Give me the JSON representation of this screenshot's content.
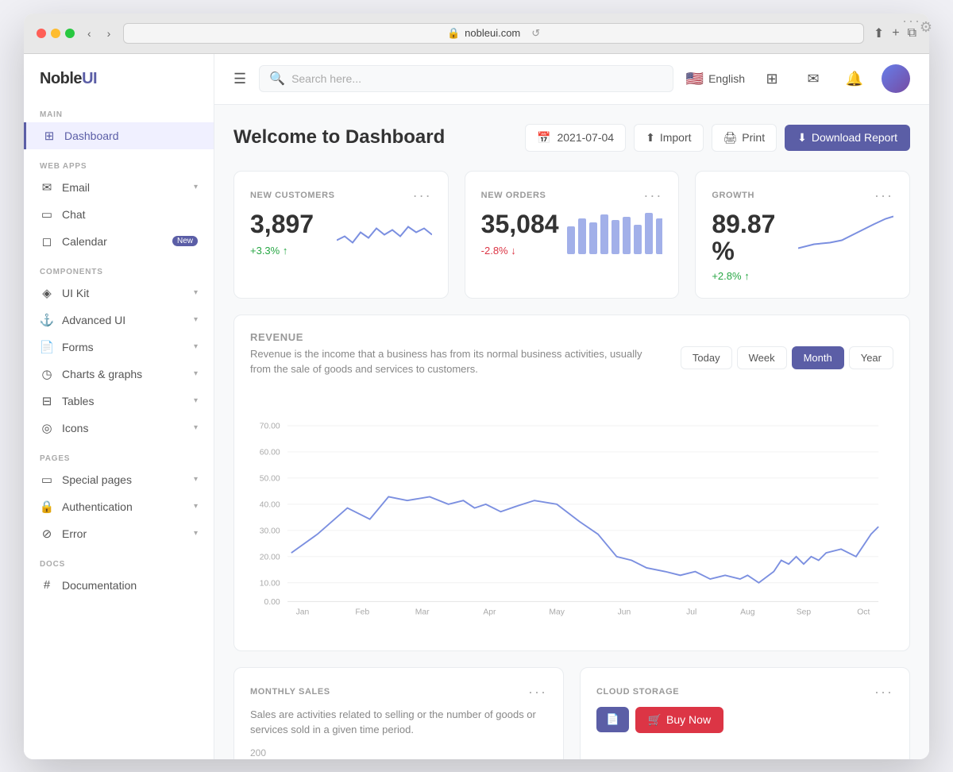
{
  "browser": {
    "url": "nobleui.com",
    "lock_icon": "🔒",
    "reload_icon": "↺"
  },
  "app": {
    "logo_noble": "Noble",
    "logo_ui": "UI"
  },
  "sidebar": {
    "sections": [
      {
        "title": "MAIN",
        "items": [
          {
            "id": "dashboard",
            "label": "Dashboard",
            "icon": "⊞",
            "active": true,
            "badge": ""
          }
        ]
      },
      {
        "title": "WEB APPS",
        "items": [
          {
            "id": "email",
            "label": "Email",
            "icon": "✉",
            "active": false,
            "badge": "",
            "hasArrow": true
          },
          {
            "id": "chat",
            "label": "Chat",
            "icon": "▭",
            "active": false,
            "badge": ""
          },
          {
            "id": "calendar",
            "label": "Calendar",
            "icon": "📅",
            "active": false,
            "badge": "New"
          }
        ]
      },
      {
        "title": "COMPONENTS",
        "items": [
          {
            "id": "ui-kit",
            "label": "UI Kit",
            "icon": "◈",
            "active": false,
            "badge": "",
            "hasArrow": true
          },
          {
            "id": "advanced-ui",
            "label": "Advanced UI",
            "icon": "⚓",
            "active": false,
            "badge": "",
            "hasArrow": true
          },
          {
            "id": "forms",
            "label": "Forms",
            "icon": "📄",
            "active": false,
            "badge": "",
            "hasArrow": true
          },
          {
            "id": "charts",
            "label": "Charts & graphs",
            "icon": "◷",
            "active": false,
            "badge": "",
            "hasArrow": true
          },
          {
            "id": "tables",
            "label": "Tables",
            "icon": "⊟",
            "active": false,
            "badge": "",
            "hasArrow": true
          },
          {
            "id": "icons",
            "label": "Icons",
            "icon": "◎",
            "active": false,
            "badge": "",
            "hasArrow": true
          }
        ]
      },
      {
        "title": "PAGES",
        "items": [
          {
            "id": "special-pages",
            "label": "Special pages",
            "icon": "▭",
            "active": false,
            "badge": "",
            "hasArrow": true
          },
          {
            "id": "authentication",
            "label": "Authentication",
            "icon": "🔒",
            "active": false,
            "badge": "",
            "hasArrow": true
          },
          {
            "id": "error",
            "label": "Error",
            "icon": "⊘",
            "active": false,
            "badge": "",
            "hasArrow": true
          }
        ]
      },
      {
        "title": "DOCS",
        "items": [
          {
            "id": "documentation",
            "label": "Documentation",
            "icon": "#",
            "active": false,
            "badge": ""
          }
        ]
      }
    ]
  },
  "header": {
    "search_placeholder": "Search here...",
    "language": "English",
    "flag": "🇺🇸"
  },
  "page": {
    "title": "Welcome to Dashboard",
    "date": "2021-07-04",
    "import_label": "Import",
    "print_label": "Print",
    "download_label": "Download Report"
  },
  "stats": {
    "new_customers": {
      "label": "NEW CUSTOMERS",
      "value": "3,897",
      "change": "+3.3%",
      "change_type": "positive"
    },
    "new_orders": {
      "label": "NEW ORDERS",
      "value": "35,084",
      "change": "-2.8%",
      "change_type": "negative"
    },
    "growth": {
      "label": "GROWTH",
      "value": "89.87",
      "value_unit": "%",
      "change": "+2.8%",
      "change_type": "positive"
    }
  },
  "revenue": {
    "title": "REVENUE",
    "description": "Revenue is the income that a business has from its normal business activities, usually from the sale of goods and services to customers.",
    "periods": [
      "Today",
      "Week",
      "Month",
      "Year"
    ],
    "active_period": "Month",
    "y_labels": [
      "70.00",
      "60.00",
      "50.00",
      "40.00",
      "30.00",
      "20.00",
      "10.00",
      "0.00"
    ],
    "x_labels": [
      "Jan",
      "Feb",
      "Mar",
      "Apr",
      "May",
      "Jun",
      "Jul",
      "Aug",
      "Sep",
      "Oct"
    ]
  },
  "monthly_sales": {
    "title": "MONTHLY SALES",
    "description": "Sales are activities related to selling or the number of goods or services sold in a given time period.",
    "y_label": "200"
  },
  "cloud_storage": {
    "title": "CLOUD STORAGE",
    "buy_now_label": "Buy Now"
  }
}
